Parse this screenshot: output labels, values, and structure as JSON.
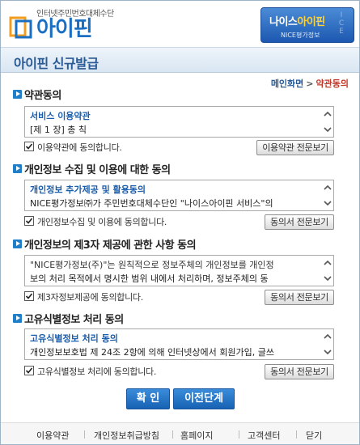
{
  "header": {
    "logo_subtitle": "인터넷주민번호대체수단",
    "logo_name": "아이핀",
    "badge_title_main": "나이스",
    "badge_title_highlight": "아이핀",
    "badge_sub": "NICE평가정보"
  },
  "page_title": "아이핀 신규발급",
  "breadcrumb": {
    "home": "메인화면",
    "separator": ">",
    "current": "약관동의"
  },
  "sections": [
    {
      "heading": "약관동의",
      "text_line1": "서비스 이용약관",
      "text_line2": "[제 1 장] 총 칙",
      "agree_label": "이용약관에 동의합니다.",
      "checked": true,
      "full_text_button": "이용약관 전문보기"
    },
    {
      "heading": "개인정보 수집 및 이용에 대한 동의",
      "text_line1": "개인정보 추가제공 및 활용동의",
      "text_line2": "NICE평가정보㈜가 주민번호대체수단인 \"나이스아이핀 서비스\"의",
      "agree_label": "개인정보수집 및 이용에 동의합니다.",
      "checked": true,
      "full_text_button": "동의서 전문보기"
    },
    {
      "heading": "개인정보의 제3자 제공에 관한 사항 동의",
      "text_line1": "\"NICE평가정보(주)\"는 원칙적으로 정보주체의 개인정보를 개인정",
      "text_line2": "보의 처리 목적에서 명시한 범위 내에서 처리하며, 정보주체의 동",
      "agree_label": "제3자정보제공에 동의합니다.",
      "checked": true,
      "full_text_button": "동의서 전문보기"
    },
    {
      "heading": "고유식별정보 처리 동의",
      "text_line1": "고유식별정보 처리 동의",
      "text_line2": "개인정보보호법 제 24조 2항에 의해 인터넷상에서 회원가입, 글쓰",
      "agree_label": "고유식별정보 처리에 동의합니다.",
      "checked": true,
      "full_text_button": "동의서 전문보기"
    }
  ],
  "actions": {
    "confirm": "확 인",
    "previous": "이전단계"
  },
  "footer": {
    "links": [
      "이용약관",
      "개인정보취급방침",
      "홈페이지",
      "고객센터",
      "닫기"
    ]
  },
  "colors": {
    "brand_blue": "#1b6fc2",
    "title_blue": "#2a5a94",
    "breadcrumb_current": "#c0392b",
    "button_blue": "#1761b3"
  }
}
